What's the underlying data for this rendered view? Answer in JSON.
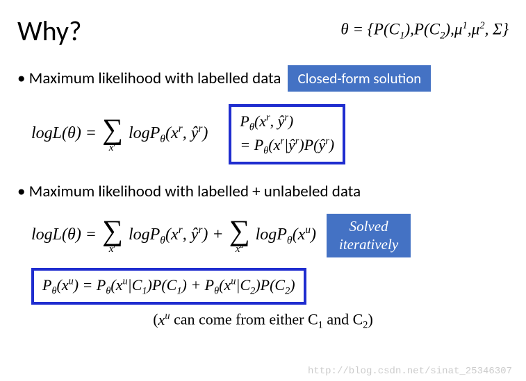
{
  "title": "Why?",
  "theta_definition": "θ = {P(C₁), P(C₂), μ¹, μ², Σ}",
  "section1": {
    "bullet": "Maximum likelihood with labelled data",
    "badge": "Closed-form solution",
    "formula_lhs": "logL(θ) =",
    "formula_sum_sub": "xʳ",
    "formula_term": "logP_θ(xʳ, ŷʳ)",
    "box_line1": "P_θ(xʳ, ŷʳ)",
    "box_line2": "= P_θ(xʳ|ŷʳ)P(ŷʳ)"
  },
  "section2": {
    "bullet": "Maximum likelihood with labelled + unlabeled data",
    "formula_lhs": "logL(θ) =",
    "formula_sum1_sub": "xʳ",
    "formula_term1": "logP_θ(xʳ, ŷʳ) +",
    "formula_sum2_sub": "xᵘ",
    "formula_term2": "logP_θ(xᵘ)",
    "badge_line1": "Solved",
    "badge_line2": "iteratively",
    "box": "P_θ(xᵘ) = P_θ(xᵘ|C₁)P(C₁) + P_θ(xᵘ|C₂)P(C₂)"
  },
  "footnote": "(xᵘ can come from either C₁ and C₂)",
  "watermark": "http://blog.csdn.net/sinat_25346307"
}
